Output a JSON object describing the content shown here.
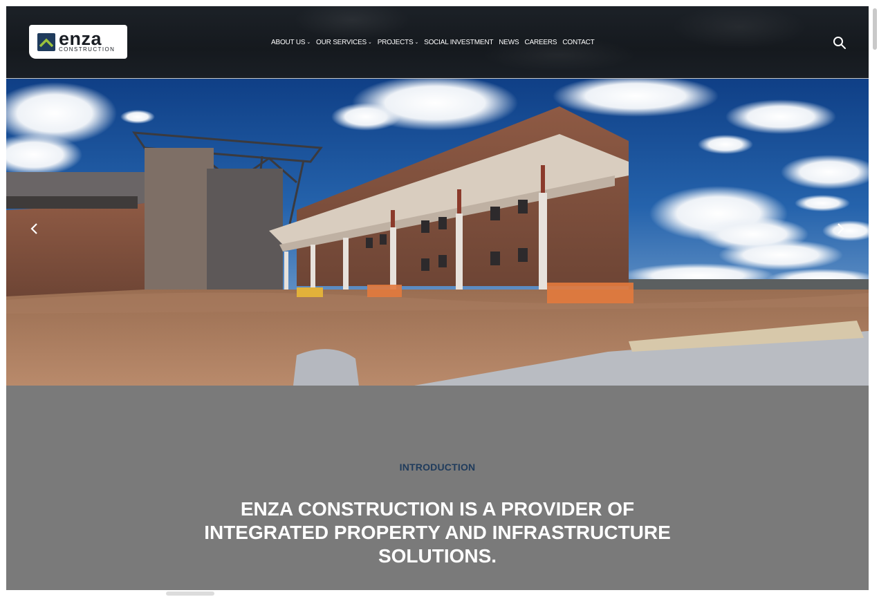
{
  "brand": {
    "name": "enza",
    "subtitle": "CONSTRUCTION",
    "primary_color": "#1f3b5c",
    "accent_color": "#9bc13c"
  },
  "nav": {
    "items": [
      {
        "label": "ABOUT US",
        "has_dropdown": true
      },
      {
        "label": "OUR SERVICES",
        "has_dropdown": true
      },
      {
        "label": "PROJECTS",
        "has_dropdown": true
      },
      {
        "label": "SOCIAL INVESTMENT",
        "has_dropdown": false
      },
      {
        "label": "NEWS",
        "has_dropdown": false
      },
      {
        "label": "CAREERS",
        "has_dropdown": false
      },
      {
        "label": "CONTACT",
        "has_dropdown": false
      }
    ],
    "search_icon": "search-icon"
  },
  "hero": {
    "prev_icon": "chevron-left-icon",
    "next_icon": "chevron-right-icon"
  },
  "intro": {
    "label": "INTRODUCTION",
    "heading": "ENZA CONSTRUCTION IS A PROVIDER OF INTEGRATED PROPERTY AND INFRASTRUCTURE SOLUTIONS."
  }
}
